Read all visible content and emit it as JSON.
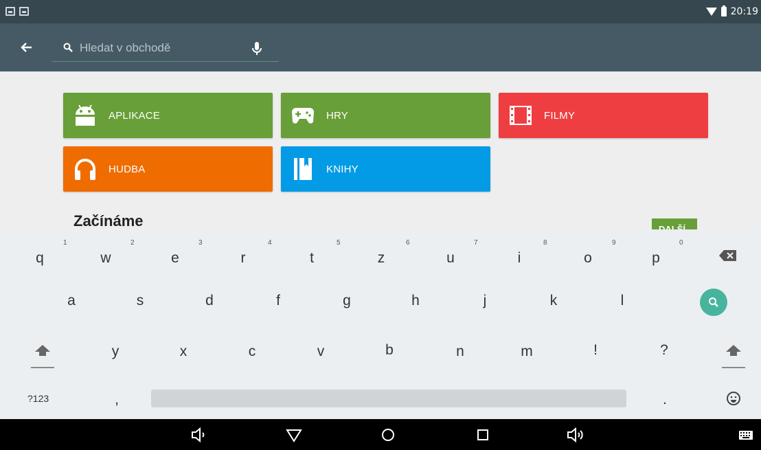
{
  "status_bar": {
    "time": "20:19",
    "icons": [
      "image-notification-icon",
      "gmail-notification-icon",
      "wifi-icon",
      "battery-icon"
    ]
  },
  "app_bar": {
    "back_icon": "arrow-back-icon",
    "search": {
      "placeholder": "Hledat v obchodě",
      "value": ""
    },
    "mic_icon": "mic-icon"
  },
  "categories": [
    {
      "label": "APLIKACE",
      "color": "#689f38",
      "icon": "android-icon"
    },
    {
      "label": "HRY",
      "color": "#689f38",
      "icon": "gamepad-icon"
    },
    {
      "label": "FILMY",
      "color": "#ef3e42",
      "icon": "film-icon"
    },
    {
      "label": "HUDBA",
      "color": "#ef6c00",
      "icon": "headphones-icon"
    },
    {
      "label": "KNIHY",
      "color": "#039be5",
      "icon": "book-icon"
    }
  ],
  "section": {
    "title": "Začínáme",
    "more_label": "DALŠÍ"
  },
  "keyboard": {
    "row1": [
      {
        "key": "q",
        "hint": "1"
      },
      {
        "key": "w",
        "hint": "2"
      },
      {
        "key": "e",
        "hint": "3"
      },
      {
        "key": "r",
        "hint": "4"
      },
      {
        "key": "t",
        "hint": "5"
      },
      {
        "key": "z",
        "hint": "6"
      },
      {
        "key": "u",
        "hint": "7"
      },
      {
        "key": "i",
        "hint": "8"
      },
      {
        "key": "o",
        "hint": "9"
      },
      {
        "key": "p",
        "hint": "0"
      }
    ],
    "row2": [
      "a",
      "s",
      "d",
      "f",
      "g",
      "h",
      "j",
      "k",
      "l"
    ],
    "row3": [
      "y",
      "x",
      "c",
      "v",
      "b",
      "n",
      "m",
      "!",
      "?"
    ],
    "symbols_label": "?123",
    "comma": ",",
    "period": "."
  },
  "colors": {
    "status_bar": "#37474f",
    "app_bar": "#455a64",
    "search_action": "#48b49e"
  }
}
